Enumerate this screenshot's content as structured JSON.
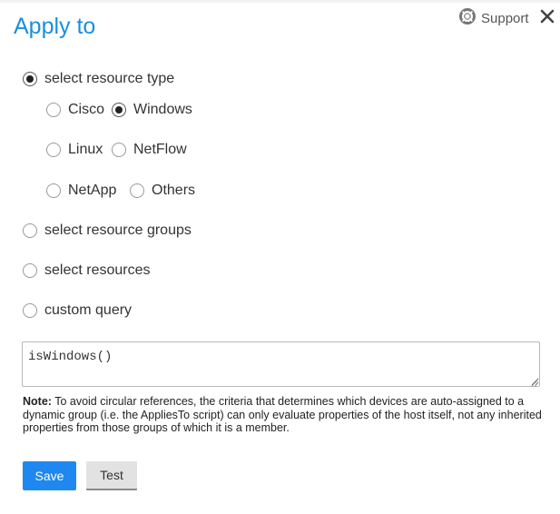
{
  "dialog": {
    "title": "Apply to",
    "support_label": "Support",
    "support_icon": "lifebuoy-icon",
    "close_icon": "close-icon"
  },
  "options": {
    "resource_type": {
      "label": "select resource type",
      "checked": true
    },
    "resource_types": [
      {
        "label": "Cisco",
        "checked": false
      },
      {
        "label": "Windows",
        "checked": true
      },
      {
        "label": "Linux",
        "checked": false
      },
      {
        "label": "NetFlow",
        "checked": false
      },
      {
        "label": "NetApp",
        "checked": false
      },
      {
        "label": "Others",
        "checked": false
      }
    ],
    "resource_groups": {
      "label": "select resource groups",
      "checked": false
    },
    "resources": {
      "label": "select resources",
      "checked": false
    },
    "custom_query": {
      "label": "custom query",
      "checked": false
    }
  },
  "query": {
    "value": "isWindows()"
  },
  "note": {
    "prefix": "Note:",
    "text": " To avoid circular references, the criteria that determines which devices are auto-assigned to a dynamic group (i.e. the AppliesTo script) can only evaluate properties of the host itself, not any inherited properties from those groups of which it is a member."
  },
  "buttons": {
    "save_label": "Save",
    "test_label": "Test"
  },
  "colors": {
    "title": "#1a8fe0",
    "save_button": "#1e88f0",
    "test_button": "#e2e2e2"
  }
}
